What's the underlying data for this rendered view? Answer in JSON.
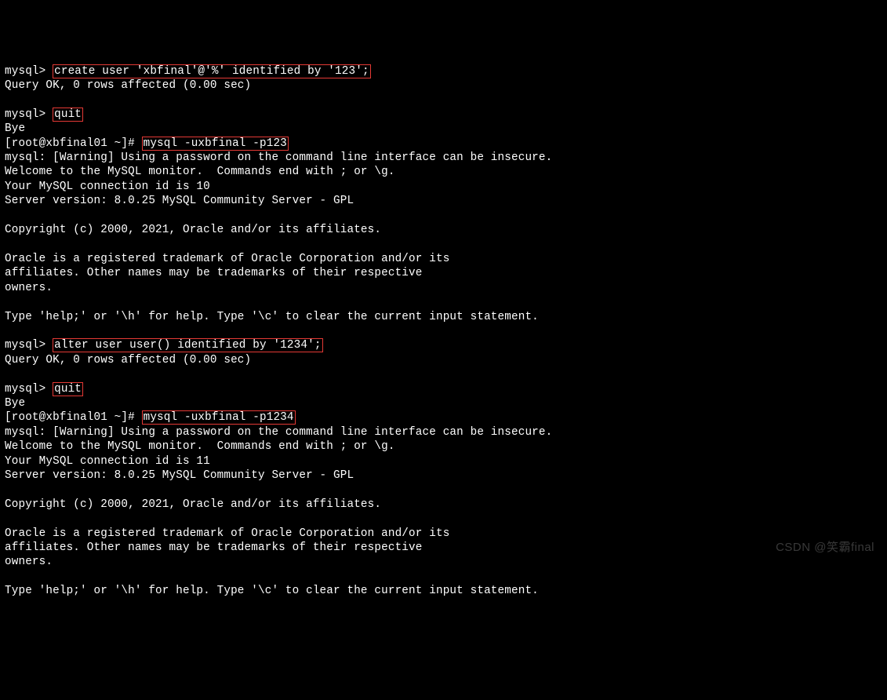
{
  "prompts": {
    "mysql": "mysql> ",
    "shell": "[root@xbfinal01 ~]# "
  },
  "cmds": {
    "create_user": "create user 'xbfinal'@'%' identified by '123';",
    "quit1": "quit",
    "shell1": "mysql -uxbfinal -p123",
    "alter_user": "alter user user() identified by '1234';",
    "quit2": "quit",
    "shell2": "mysql -uxbfinal -p1234"
  },
  "out": {
    "query_ok": "Query OK, 0 rows affected (0.00 sec)",
    "bye": "Bye",
    "warn": "mysql: [Warning] Using a password on the command line interface can be insecure.",
    "welcome": "Welcome to the MySQL monitor.  Commands end with ; or \\g.",
    "conn10": "Your MySQL connection id is 10",
    "conn11": "Your MySQL connection id is 11",
    "server": "Server version: 8.0.25 MySQL Community Server - GPL",
    "copyright": "Copyright (c) 2000, 2021, Oracle and/or its affiliates.",
    "tm1": "Oracle is a registered trademark of Oracle Corporation and/or its",
    "tm2": "affiliates. Other names may be trademarks of their respective",
    "tm3": "owners.",
    "help": "Type 'help;' or '\\h' for help. Type '\\c' to clear the current input statement."
  },
  "watermark": "CSDN @笑霸final"
}
